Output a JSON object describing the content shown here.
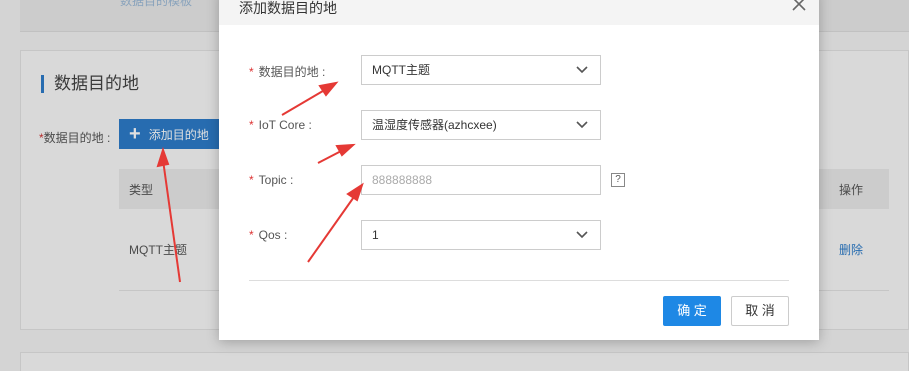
{
  "background": {
    "top_link": "数据目的模板",
    "section_title": "数据目的地",
    "dest_label": "数据目的地 :",
    "add_button": "添加目的地",
    "table": {
      "col_type": "类型",
      "col_action": "操作",
      "row": {
        "type": "MQTT主题",
        "action": "删除"
      }
    }
  },
  "modal": {
    "title": "添加数据目的地",
    "fields": {
      "destination": {
        "label": "数据目的地 :",
        "value": "MQTT主题"
      },
      "iot_core": {
        "label": "IoT Core :",
        "value": "温湿度传感器(azhcxee)"
      },
      "topic": {
        "label": "Topic :",
        "placeholder": "888888888",
        "help": "?"
      },
      "qos": {
        "label": "Qos :",
        "value": "1"
      }
    },
    "ok_label": "确 定",
    "cancel_label": "取 消"
  },
  "colors": {
    "primary": "#1e88e5",
    "arrow": "#e53935",
    "required": "#d33333"
  },
  "icons": {
    "close": "close-icon",
    "dropdown": "chevron-down-icon",
    "help": "help-icon",
    "add": "plus-icon"
  }
}
